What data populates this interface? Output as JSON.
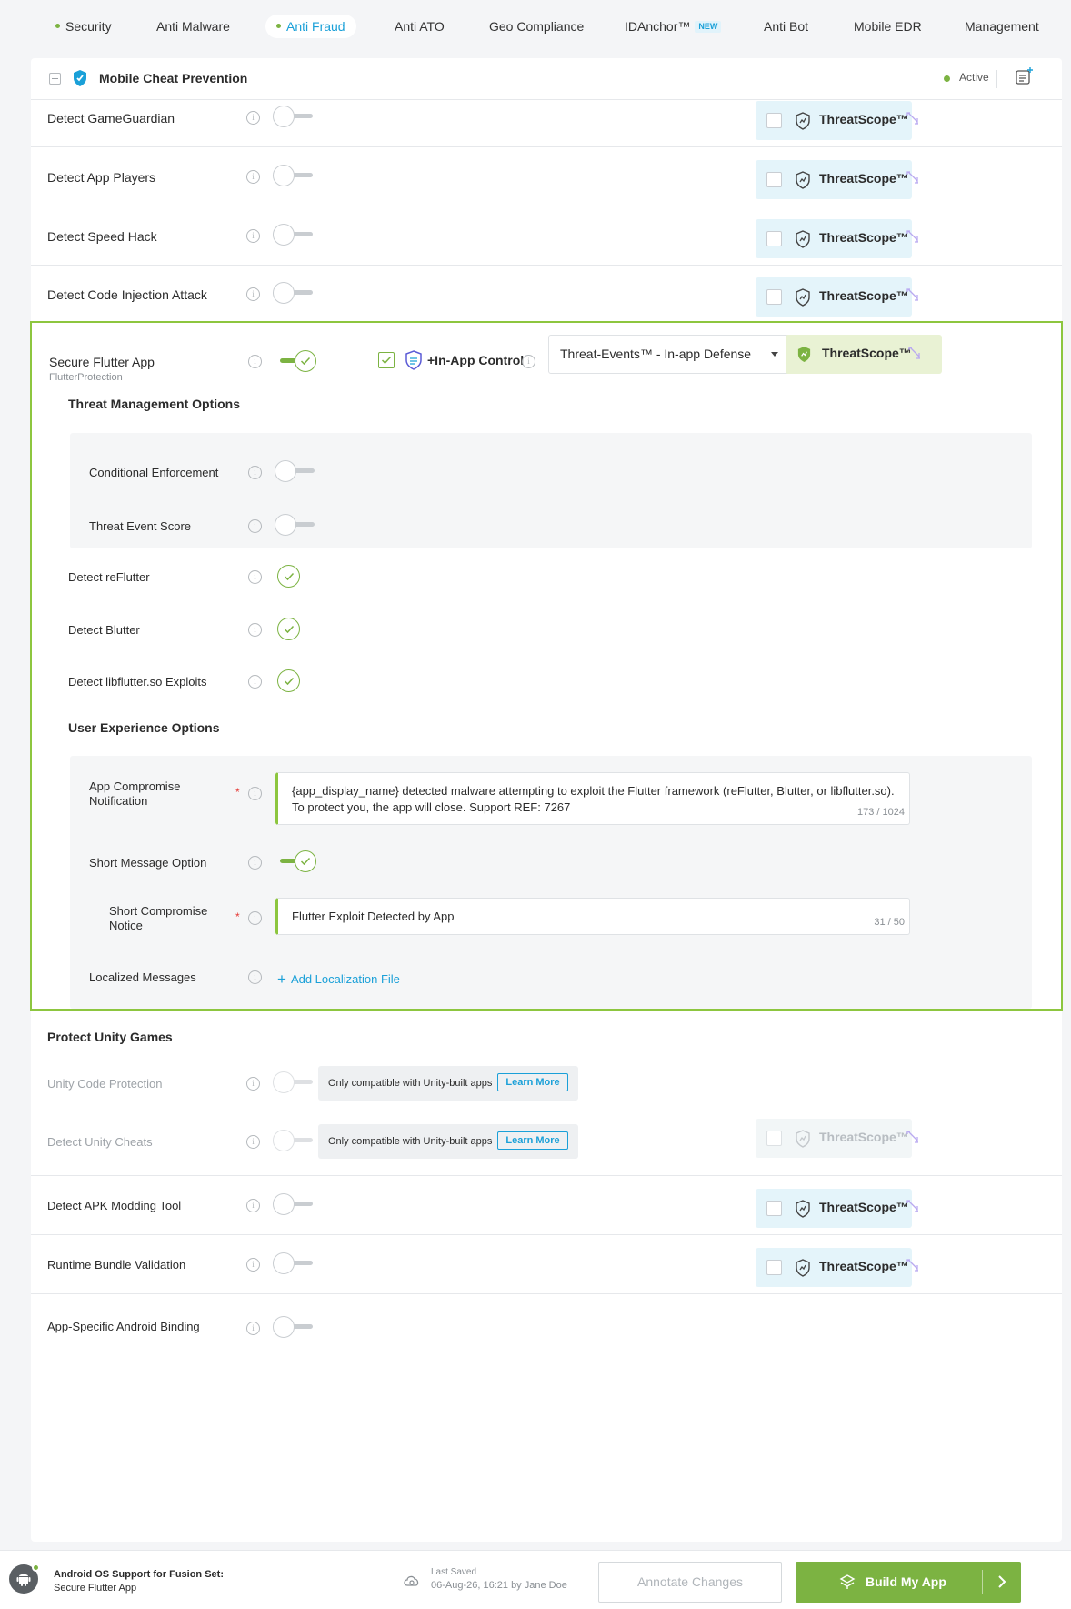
{
  "tabs": [
    {
      "label": "Security",
      "dot": true
    },
    {
      "label": "Anti Malware"
    },
    {
      "label": "Anti Fraud",
      "dot": true,
      "active": true
    },
    {
      "label": "Anti ATO"
    },
    {
      "label": "Geo Compliance"
    },
    {
      "label": "IDAnchor™",
      "badge": "NEW"
    },
    {
      "label": "Anti Bot"
    },
    {
      "label": "Mobile EDR"
    },
    {
      "label": "Management"
    }
  ],
  "card": {
    "title": "Mobile Cheat Prevention",
    "status": "Active",
    "status_color": "#7cb342"
  },
  "threatscope_label": "ThreatScope™",
  "rows": [
    {
      "label": "Detect GameGuardian",
      "enabled": false
    },
    {
      "label": "Detect App Players",
      "enabled": false
    },
    {
      "label": "Detect Speed Hack",
      "enabled": false
    },
    {
      "label": "Detect Code Injection Attack",
      "enabled": false
    }
  ],
  "flutter": {
    "label": "Secure Flutter App",
    "sublabel": "FlutterProtection",
    "enabled": true,
    "in_app_control": "+In-App Control",
    "defense_select": "Threat-Events™ - In-app Defense",
    "threat_mgmt_title": "Threat Management Options",
    "conditional_enforcement": "Conditional Enforcement",
    "threat_event_score": "Threat Event Score",
    "checks": [
      "Detect reFlutter",
      "Detect Blutter",
      "Detect libflutter.so Exploits"
    ],
    "ux_title": "User Experience Options",
    "app_compromise_label": "App Compromise Notification",
    "app_compromise_text": "{app_display_name} detected malware attempting to exploit the Flutter framework (reFlutter, Blutter, or libflutter.so). To protect you, the app will close. Support REF: 7267",
    "app_compromise_count": "173 / 1024",
    "short_message_label": "Short Message Option",
    "short_notice_label": "Short Compromise Notice",
    "short_notice_text": "Flutter Exploit Detected by App",
    "short_notice_count": "31 / 50",
    "localized_label": "Localized Messages",
    "add_localization": "Add Localization File"
  },
  "unity": {
    "title": "Protect Unity Games",
    "code_protection": "Unity Code Protection",
    "detect_cheats": "Detect Unity Cheats",
    "compat_text": "Only compatible with Unity-built apps",
    "learn_more": "Learn More"
  },
  "bottom_rows": [
    {
      "label": "Detect APK Modding Tool"
    },
    {
      "label": "Runtime Bundle Validation"
    },
    {
      "label": "App-Specific Android Binding"
    }
  ],
  "footer": {
    "title": "Android OS Support for Fusion Set:",
    "subtitle": "Secure Flutter App",
    "last_saved_label": "Last Saved",
    "last_saved_value": "06-Aug-26, 16:21 by Jane Doe",
    "annotate": "Annotate Changes",
    "build": "Build My App"
  },
  "colors": {
    "accent_green": "#7cb342",
    "accent_blue": "#1aa0d8",
    "threatscope_bg": "#e4f4fa"
  }
}
